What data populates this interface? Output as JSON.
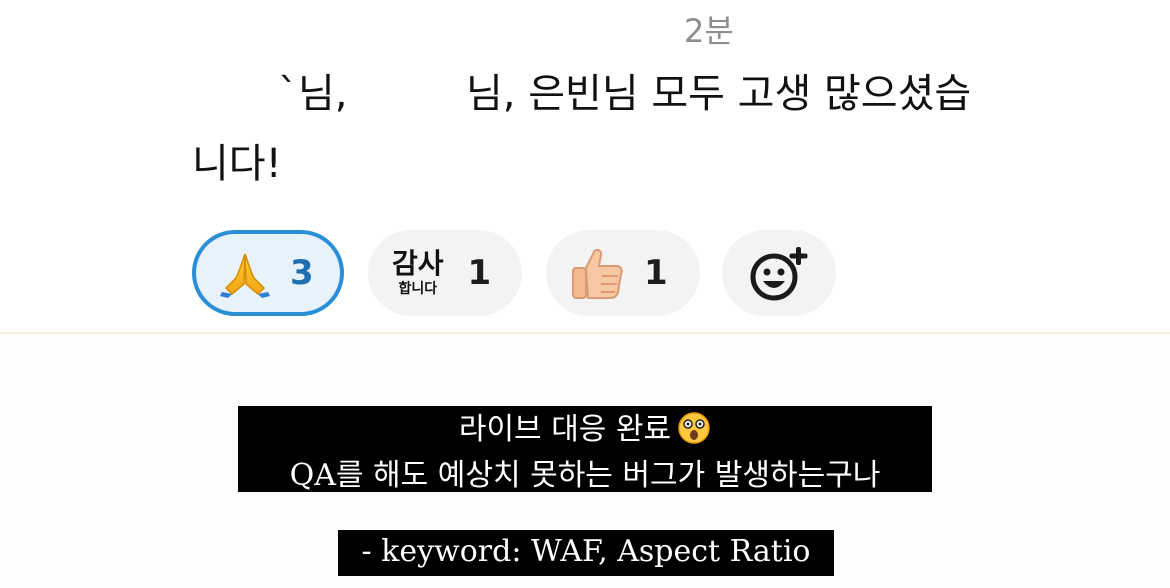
{
  "message": {
    "timestamp": "2분",
    "line1_part_a": "`님,",
    "line1_part_b": "님, 은빈님 모두 고생 많으셨습",
    "line2": "니다!"
  },
  "reactions": [
    {
      "icon": "folded-hands-emoji",
      "count": "3",
      "active": true
    },
    {
      "icon": "thanks-badge",
      "badge_top": "감사",
      "badge_bottom": "합니다",
      "count": "1",
      "active": false
    },
    {
      "icon": "thumbs-up-emoji",
      "count": "1",
      "active": false
    },
    {
      "icon": "add-reaction-icon",
      "active": false
    }
  ],
  "story": {
    "caption_line1": "라이브 대응 완료",
    "caption_emoji": "dizzy-face-emoji",
    "caption_line2": "QA를 해도 예상치 못하는 버그가 발생하는구나",
    "caption_keyword": "- keyword: WAF, Aspect Ratio"
  },
  "colors": {
    "active_pill_border": "#2b8fd6",
    "active_pill_bg": "#e8f2fa",
    "pill_bg": "#f3f3f3",
    "caption_bg": "#000000",
    "caption_text": "#ffffff",
    "timestamp": "#8e8e8e"
  }
}
